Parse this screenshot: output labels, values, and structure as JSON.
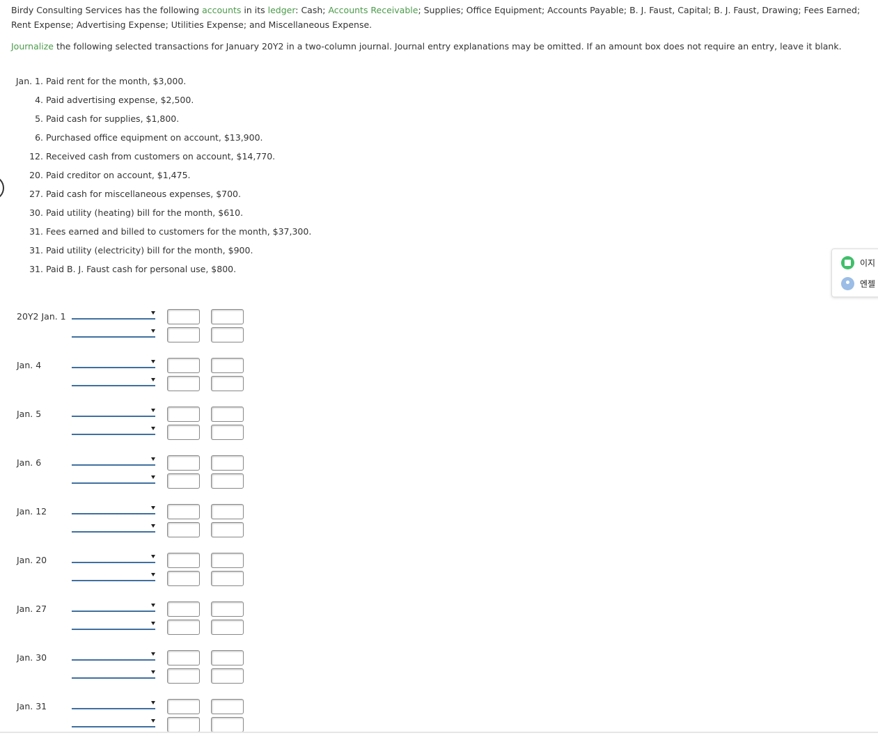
{
  "intro": {
    "part1": "Birdy Consulting Services has the following ",
    "link1": "accounts",
    "part2": " in its ",
    "link2": "ledger",
    "part3": ": Cash; ",
    "link3": "Accounts Receivable",
    "part4": "; Supplies; Office Equipment; Accounts Payable; B. J. Faust, Capital; B. J. Faust, Drawing; Fees Earned; Rent Expense; Advertising Expense; Utilities Expense; and Miscellaneous Expense."
  },
  "instruction": {
    "link": "Journalize",
    "text": " the following selected transactions for January 20Y2 in a two-column journal. Journal entry explanations may be omitted. If an amount box does not require an entry, leave it blank."
  },
  "transactions": [
    {
      "label": "Jan. 1.",
      "text": "Paid rent for the month, $3,000."
    },
    {
      "label": "4.",
      "text": "Paid advertising expense, $2,500."
    },
    {
      "label": "5.",
      "text": "Paid cash for supplies, $1,800."
    },
    {
      "label": "6.",
      "text": "Purchased office equipment on account, $13,900."
    },
    {
      "label": "12.",
      "text": "Received cash from customers on account, $14,770."
    },
    {
      "label": "20.",
      "text": "Paid creditor on account, $1,475."
    },
    {
      "label": "27.",
      "text": "Paid cash for miscellaneous expenses, $700."
    },
    {
      "label": "30.",
      "text": "Paid utility (heating) bill for the month, $610."
    },
    {
      "label": "31.",
      "text": "Fees earned and billed to customers for the month, $37,300."
    },
    {
      "label": "31.",
      "text": "Paid utility (electricity) bill for the month, $900."
    },
    {
      "label": "31.",
      "text": "Paid B. J. Faust cash for personal use, $800."
    }
  ],
  "journal": {
    "dates": [
      "20Y2 Jan. 1",
      "Jan. 4",
      "Jan. 5",
      "Jan. 6",
      "Jan. 12",
      "Jan. 20",
      "Jan. 27",
      "Jan. 30",
      "Jan. 31"
    ]
  },
  "widget": {
    "items": [
      {
        "label": "이지",
        "icon": "calendar-icon",
        "color": "#3fbf6a"
      },
      {
        "label": "엔젤",
        "icon": "user-icon",
        "color": "#9bbde6"
      }
    ]
  },
  "colors": {
    "link": "#4a9a4a",
    "select_underline": "#3f6f9f",
    "text": "#333333"
  }
}
